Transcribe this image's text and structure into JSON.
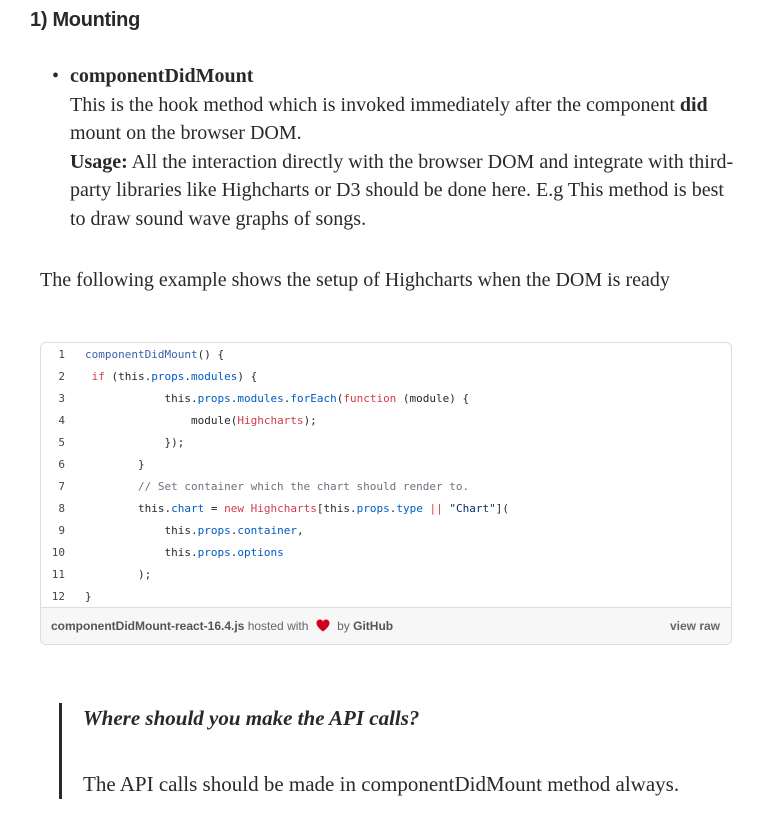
{
  "article": {
    "heading": "1) Mounting",
    "bullet": {
      "term": "componentDidMount",
      "desc_a": "This is the hook method which is invoked immediately after the component ",
      "desc_bold": "did",
      "desc_b": " mount on the browser DOM.",
      "usage_label": "Usage:",
      "usage_text": " All the interaction directly with the browser DOM and integrate with third-party libraries like Highcharts or D3 should be done here. E.g This method is best to draw sound wave graphs of songs."
    },
    "intro": "The following example shows the setup of Highcharts when the DOM is ready"
  },
  "gist": {
    "lines": [
      {
        "n": "1",
        "indent": "",
        "tokens": [
          {
            "c": "fn",
            "t": "componentDidMount"
          },
          {
            "c": "",
            "t": "() {"
          }
        ]
      },
      {
        "n": "2",
        "indent": " ",
        "tokens": [
          {
            "c": "kw",
            "t": "if"
          },
          {
            "c": "",
            "t": " (this."
          },
          {
            "c": "prop",
            "t": "props"
          },
          {
            "c": "",
            "t": "."
          },
          {
            "c": "prop",
            "t": "modules"
          },
          {
            "c": "",
            "t": ") {"
          }
        ]
      },
      {
        "n": "3",
        "indent": "            ",
        "tokens": [
          {
            "c": "",
            "t": "this."
          },
          {
            "c": "prop",
            "t": "props"
          },
          {
            "c": "",
            "t": "."
          },
          {
            "c": "prop",
            "t": "modules"
          },
          {
            "c": "",
            "t": "."
          },
          {
            "c": "prop",
            "t": "forEach"
          },
          {
            "c": "",
            "t": "("
          },
          {
            "c": "kw",
            "t": "function"
          },
          {
            "c": "",
            "t": " (module) {"
          }
        ]
      },
      {
        "n": "4",
        "indent": "                ",
        "tokens": [
          {
            "c": "",
            "t": "module("
          },
          {
            "c": "kw",
            "t": "Highcharts"
          },
          {
            "c": "",
            "t": ");"
          }
        ]
      },
      {
        "n": "5",
        "indent": "            ",
        "tokens": [
          {
            "c": "",
            "t": "});"
          }
        ]
      },
      {
        "n": "6",
        "indent": "        ",
        "tokens": [
          {
            "c": "",
            "t": "}"
          }
        ]
      },
      {
        "n": "7",
        "indent": "        ",
        "tokens": [
          {
            "c": "cm",
            "t": "// Set container which the chart should render to."
          }
        ]
      },
      {
        "n": "8",
        "indent": "        ",
        "tokens": [
          {
            "c": "",
            "t": "this."
          },
          {
            "c": "prop",
            "t": "chart"
          },
          {
            "c": "",
            "t": " = "
          },
          {
            "c": "kw",
            "t": "new"
          },
          {
            "c": "",
            "t": " "
          },
          {
            "c": "kw",
            "t": "Highcharts"
          },
          {
            "c": "",
            "t": "[this."
          },
          {
            "c": "prop",
            "t": "props"
          },
          {
            "c": "",
            "t": "."
          },
          {
            "c": "prop",
            "t": "type"
          },
          {
            "c": "",
            "t": " "
          },
          {
            "c": "kw",
            "t": "||"
          },
          {
            "c": "",
            "t": " "
          },
          {
            "c": "str",
            "t": "\"Chart\""
          },
          {
            "c": "",
            "t": "]("
          }
        ]
      },
      {
        "n": "9",
        "indent": "            ",
        "tokens": [
          {
            "c": "",
            "t": "this."
          },
          {
            "c": "prop",
            "t": "props"
          },
          {
            "c": "",
            "t": "."
          },
          {
            "c": "prop",
            "t": "container"
          },
          {
            "c": "",
            "t": ","
          }
        ]
      },
      {
        "n": "10",
        "indent": "            ",
        "tokens": [
          {
            "c": "",
            "t": "this."
          },
          {
            "c": "prop",
            "t": "props"
          },
          {
            "c": "",
            "t": "."
          },
          {
            "c": "prop",
            "t": "options"
          }
        ]
      },
      {
        "n": "11",
        "indent": "        ",
        "tokens": [
          {
            "c": "",
            "t": ");"
          }
        ]
      },
      {
        "n": "12",
        "indent": "",
        "tokens": [
          {
            "c": "",
            "t": "}"
          }
        ]
      }
    ],
    "meta": {
      "filename": "componentDidMount-react-16.4.js",
      "hosted_with": "hosted with",
      "heart_icon": "heart-icon",
      "heart_color": "#d1001f",
      "by": "by",
      "github": "GitHub",
      "view_raw": "view raw"
    }
  },
  "quote": {
    "question": "Where should you make the API calls?",
    "answer": "The API calls should be made in componentDidMount method always."
  }
}
